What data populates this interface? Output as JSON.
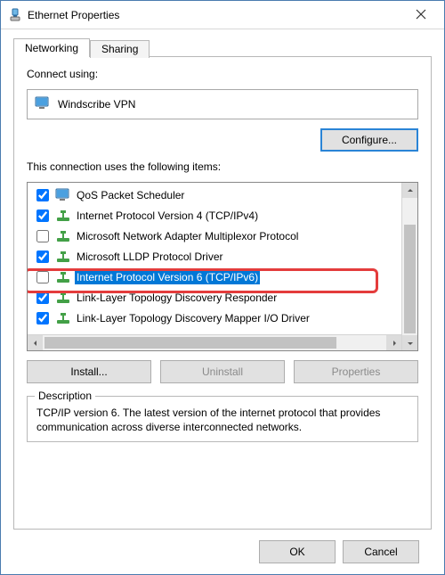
{
  "window": {
    "title": "Ethernet Properties"
  },
  "tabs": {
    "networking": "Networking",
    "sharing": "Sharing"
  },
  "connect_using_label": "Connect using:",
  "adapter_name": "Windscribe VPN",
  "configure_button": "Configure...",
  "items_label": "This connection uses the following items:",
  "items": [
    {
      "checked": true,
      "icon": "monitor",
      "label": "QoS Packet Scheduler",
      "selected": false
    },
    {
      "checked": true,
      "icon": "net",
      "label": "Internet Protocol Version 4 (TCP/IPv4)",
      "selected": false
    },
    {
      "checked": false,
      "icon": "net",
      "label": "Microsoft Network Adapter Multiplexor Protocol",
      "selected": false
    },
    {
      "checked": true,
      "icon": "net",
      "label": "Microsoft LLDP Protocol Driver",
      "selected": false
    },
    {
      "checked": false,
      "icon": "net",
      "label": "Internet Protocol Version 6 (TCP/IPv6)",
      "selected": true
    },
    {
      "checked": true,
      "icon": "net",
      "label": "Link-Layer Topology Discovery Responder",
      "selected": false
    },
    {
      "checked": true,
      "icon": "net",
      "label": "Link-Layer Topology Discovery Mapper I/O Driver",
      "selected": false
    }
  ],
  "buttons": {
    "install": "Install...",
    "uninstall": "Uninstall",
    "properties": "Properties",
    "ok": "OK",
    "cancel": "Cancel"
  },
  "description": {
    "legend": "Description",
    "text": "TCP/IP version 6. The latest version of the internet protocol that provides communication across diverse interconnected networks."
  }
}
